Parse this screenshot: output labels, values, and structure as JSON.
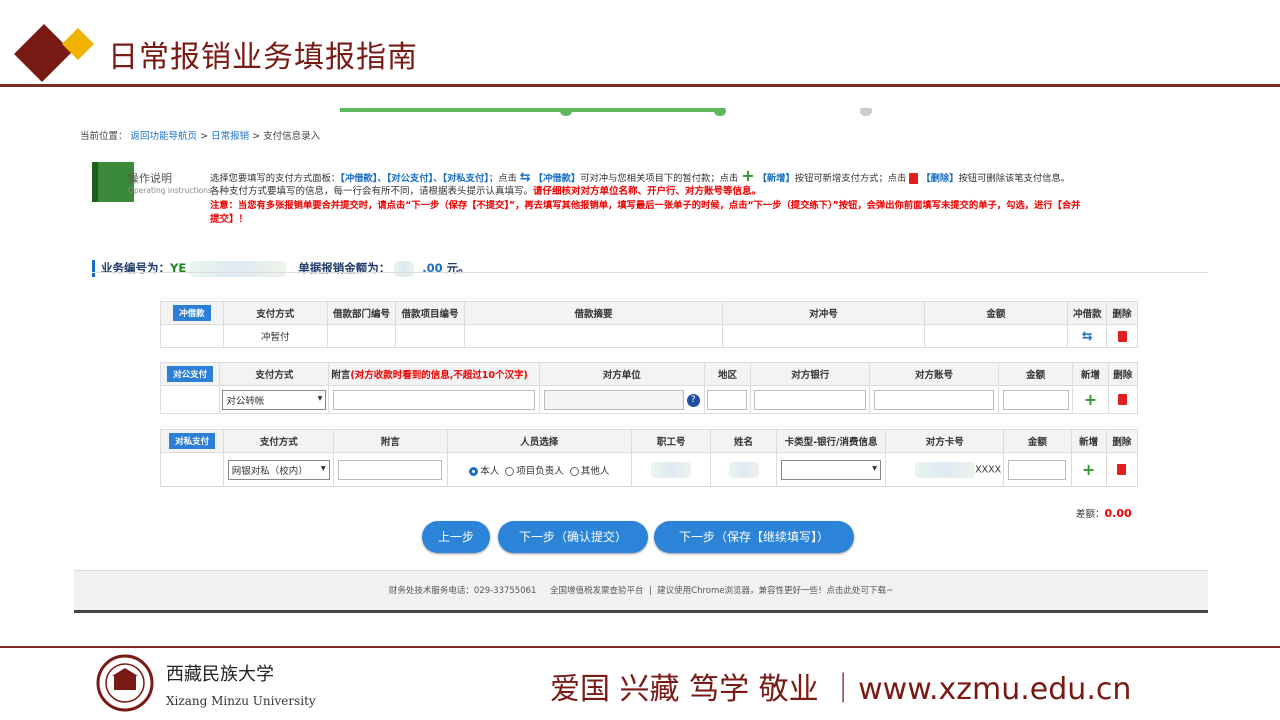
{
  "slide": {
    "title": "日常报销业务填报指南",
    "slogan": "爱国 兴藏 笃学 敬业 ｜www.xzmu.edu.cn",
    "univ_name": "西藏民族大学",
    "univ_en": "Xizang Minzu University"
  },
  "breadcrumb": {
    "prefix": "当前位置：",
    "home": "返回功能导航页",
    "sep": ">",
    "section": "日常报销",
    "current": "支付信息录入"
  },
  "help": {
    "title": "操作说明",
    "subtitle": "Operating instructions",
    "line1_a": "选择您要填写的支付方式面板：",
    "line1_b": "【冲借款】、【对公支付】、【对私支付】",
    "line1_c": "；点击",
    "line1_d": "【冲借款】",
    "line1_e": "可对冲与您相关项目下的暂付款；点击",
    "line1_f": "【新增】",
    "line1_g": "按钮可新增支付方式；点击",
    "line1_h": "【删除】",
    "line1_i": "按钮可删除该笔支付信息。",
    "line2_a": "各种支付方式要填写的信息，每一行会有所不同，请根据表头提示认真填写。",
    "line2_b": "请仔细核对对方单位名称、开户行、对方账号等信息。",
    "line3": "注意：当您有多张报销单要合并提交时，请点击“下一步（保存【不提交】”，再去填写其他报销单，填写最后一张单子的时候，点击“下一步（提交练下）”按钮，会弹出你前面填写未提交的单子，勾选，进行【合并",
    "line4": "提交】！"
  },
  "business": {
    "number_label": "业务编号为：",
    "number_prefix": "YE",
    "amount_label": "单据报销金额为：",
    "amount_value": ".00",
    "amount_unit": "元。"
  },
  "loan_table": {
    "tag": "冲借款",
    "headers": [
      "支付方式",
      "借款部门编号",
      "借款项目编号",
      "借款摘要",
      "对冲号",
      "金额",
      "冲借款",
      "删除"
    ],
    "row_method": "冲暂付"
  },
  "public_table": {
    "tag": "对公支付",
    "headers": [
      "支付方式",
      "附言",
      "对方单位",
      "地区",
      "对方银行",
      "对方账号",
      "金额",
      "新增",
      "删除"
    ],
    "memo_hint": "(对方收款时看到的信息,不超过10个汉字)",
    "method_value": "对公转帐",
    "help_glyph": "?"
  },
  "private_table": {
    "tag": "对私支付",
    "headers": [
      "支付方式",
      "附言",
      "人员选择",
      "职工号",
      "姓名",
      "卡类型-银行/消费信息",
      "对方卡号",
      "金额",
      "新增",
      "删除"
    ],
    "method_value": "网银对私（校内）",
    "radio_self": "本人",
    "radio_leader": "项目负责人",
    "radio_other": "其他人",
    "card_tail": "XXXX"
  },
  "difference": {
    "label": "差额：",
    "value": "0.00"
  },
  "buttons": {
    "prev": "上一步",
    "next_submit": "下一步（确认提交）",
    "next_save": "下一步（保存【继续填写】）"
  },
  "footer": {
    "phone": "财务处技术服务电话：029-33755061",
    "platform": "全国增值税发票查验平台",
    "divider": "|",
    "browser": "建议使用Chrome浏览器，兼容性更好一些！点击此处可下载~"
  },
  "colors": {
    "brand": "#7a1a14",
    "accent": "#2b84d8",
    "success": "#2e9a2e",
    "danger": "#e02020"
  }
}
